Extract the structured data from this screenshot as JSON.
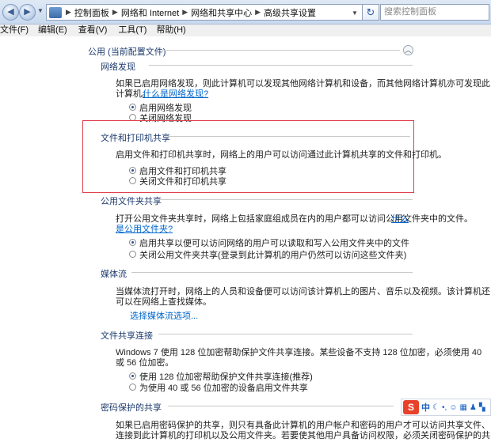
{
  "address_bar": {
    "back": "◀",
    "forward": "▶",
    "crumbs": [
      "控制面板",
      "网络和 Internet",
      "网络和共享中心",
      "高级共享设置"
    ],
    "search_placeholder": "搜索控制面板"
  },
  "menu": [
    "文件(F)",
    "编辑(E)",
    "查看(V)",
    "工具(T)",
    "帮助(H)"
  ],
  "profile": {
    "title": "公用 (当前配置文件)"
  },
  "sections": {
    "network_discovery": {
      "title": "网络发现",
      "desc1": "如果已启用网络发现，则此计算机可以发现其他网络计算机和设备，而其他网络计算机亦可发现此",
      "desc2": "计算机。",
      "link": "什么是网络发现?",
      "opt_on": "启用网络发现",
      "opt_off": "关闭网络发现"
    },
    "file_printer": {
      "title": "文件和打印机共享",
      "desc": "启用文件和打印机共享时，网络上的用户可以访问通过此计算机共享的文件和打印机。",
      "opt_on": "启用文件和打印机共享",
      "opt_off": "关闭文件和打印机共享"
    },
    "public_folder": {
      "title": "公用文件夹共享",
      "desc1": "打开公用文件夹共享时，网络上包括家庭组成员在内的用户都可以访问公用文件夹中的文件。",
      "link1": "什么",
      "link2": "是公用文件夹?",
      "opt_on": "启用共享以便可以访问网络的用户可以读取和写入公用文件夹中的文件",
      "opt_off": "关闭公用文件夹共享(登录到此计算机的用户仍然可以访问这些文件夹)"
    },
    "media": {
      "title": "媒体流",
      "desc1": "当媒体流打开时，网络上的人员和设备便可以访问该计算机上的图片、音乐以及视频。该计算机还",
      "desc2": "可以在网络上查找媒体。",
      "link": "选择媒体流选项..."
    },
    "connections": {
      "title": "文件共享连接",
      "desc1": "Windows 7 使用 128 位加密帮助保护文件共享连接。某些设备不支持 128 位加密，必须使用 40",
      "desc2": "或 56 位加密。",
      "opt_128": "使用 128 位加密帮助保护文件共享连接(推荐)",
      "opt_40": "为使用 40 或 56 位加密的设备启用文件共享"
    },
    "password": {
      "title": "密码保护的共享",
      "desc1": "如果已启用密码保护的共享，则只有具备此计算机的用户帐户和密码的用户才可以访问共享文件、",
      "desc2": "连接到此计算机的打印机以及公用文件夹。若要使其他用户具备访问权限，必须关闭密码保护的共"
    }
  },
  "ime": {
    "logo": "S",
    "mode": "中"
  },
  "colors": {
    "highlight_box": "#e0404c",
    "link": "#0066cc"
  }
}
